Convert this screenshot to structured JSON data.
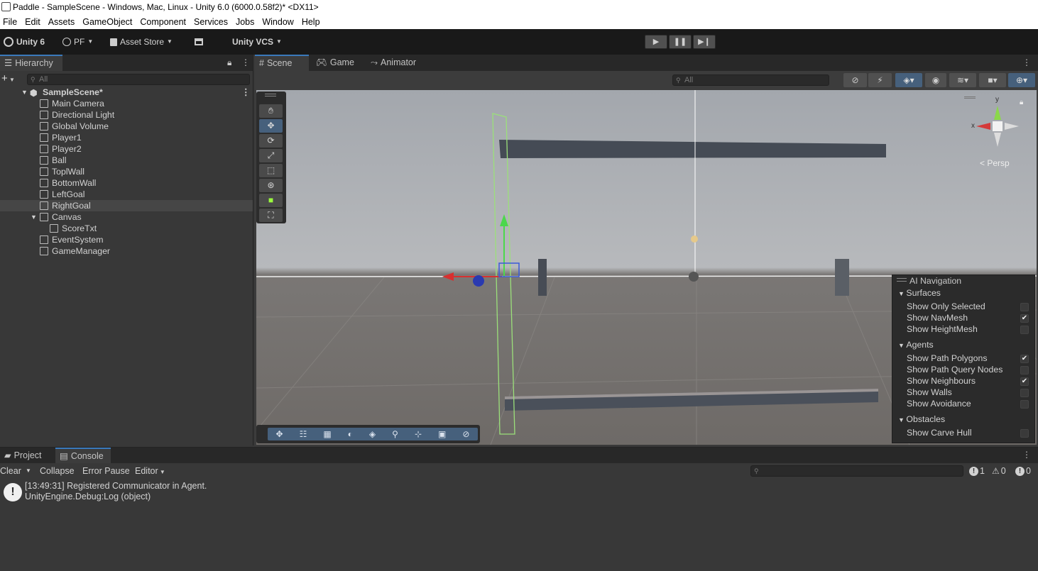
{
  "window": {
    "title": "Paddle - SampleScene - Windows, Mac, Linux - Unity 6.0 (6000.0.58f2)* <DX11>"
  },
  "menu": [
    "File",
    "Edit",
    "Assets",
    "GameObject",
    "Component",
    "Services",
    "Jobs",
    "Window",
    "Help"
  ],
  "toolbar": {
    "account": "Unity 6",
    "pf": "PF",
    "asset_store": "Asset Store",
    "vcs": "Unity VCS"
  },
  "hierarchy": {
    "tab": "Hierarchy",
    "search_placeholder": "All",
    "scene": "SampleScene*",
    "items": [
      {
        "label": "Main Camera"
      },
      {
        "label": "Directional Light"
      },
      {
        "label": "Global Volume"
      },
      {
        "label": "Player1"
      },
      {
        "label": "Player2"
      },
      {
        "label": "Ball"
      },
      {
        "label": "ToplWall"
      },
      {
        "label": "BottomWall"
      },
      {
        "label": "LeftGoal"
      },
      {
        "label": "RightGoal",
        "selected": true
      },
      {
        "label": "Canvas",
        "expanded": true
      },
      {
        "label": "ScoreTxt",
        "child": true
      },
      {
        "label": "EventSystem"
      },
      {
        "label": "GameManager"
      }
    ]
  },
  "scene_tabs": [
    "Scene",
    "Game",
    "Animator"
  ],
  "scene_search_placeholder": "All",
  "gizmo": {
    "x_label": "x",
    "y_label": "y",
    "persp": "< Persp"
  },
  "ai_navigation": {
    "title": "AI Navigation",
    "surfaces": {
      "header": "Surfaces",
      "items": [
        {
          "label": "Show Only Selected",
          "checked": false
        },
        {
          "label": "Show NavMesh",
          "checked": true
        },
        {
          "label": "Show HeightMesh",
          "checked": false
        }
      ]
    },
    "agents": {
      "header": "Agents",
      "items": [
        {
          "label": "Show Path Polygons",
          "checked": true
        },
        {
          "label": "Show Path Query Nodes",
          "checked": false
        },
        {
          "label": "Show Neighbours",
          "checked": true
        },
        {
          "label": "Show Walls",
          "checked": false
        },
        {
          "label": "Show Avoidance",
          "checked": false
        }
      ]
    },
    "obstacles": {
      "header": "Obstacles",
      "items": [
        {
          "label": "Show Carve Hull",
          "checked": false
        }
      ]
    }
  },
  "console": {
    "tabs": [
      "Project",
      "Console"
    ],
    "clear": "Clear",
    "collapse": "Collapse",
    "error_pause": "Error Pause",
    "editor": "Editor",
    "counts": {
      "logs": "1",
      "warnings": "0",
      "errors": "0"
    },
    "entry_line1": "[13:49:31] Registered Communicator in Agent.",
    "entry_line2": "UnityEngine.Debug:Log (object)"
  },
  "colors": {
    "accent": "#3a79bb",
    "selected_row": "#464646",
    "panel": "#383838"
  }
}
